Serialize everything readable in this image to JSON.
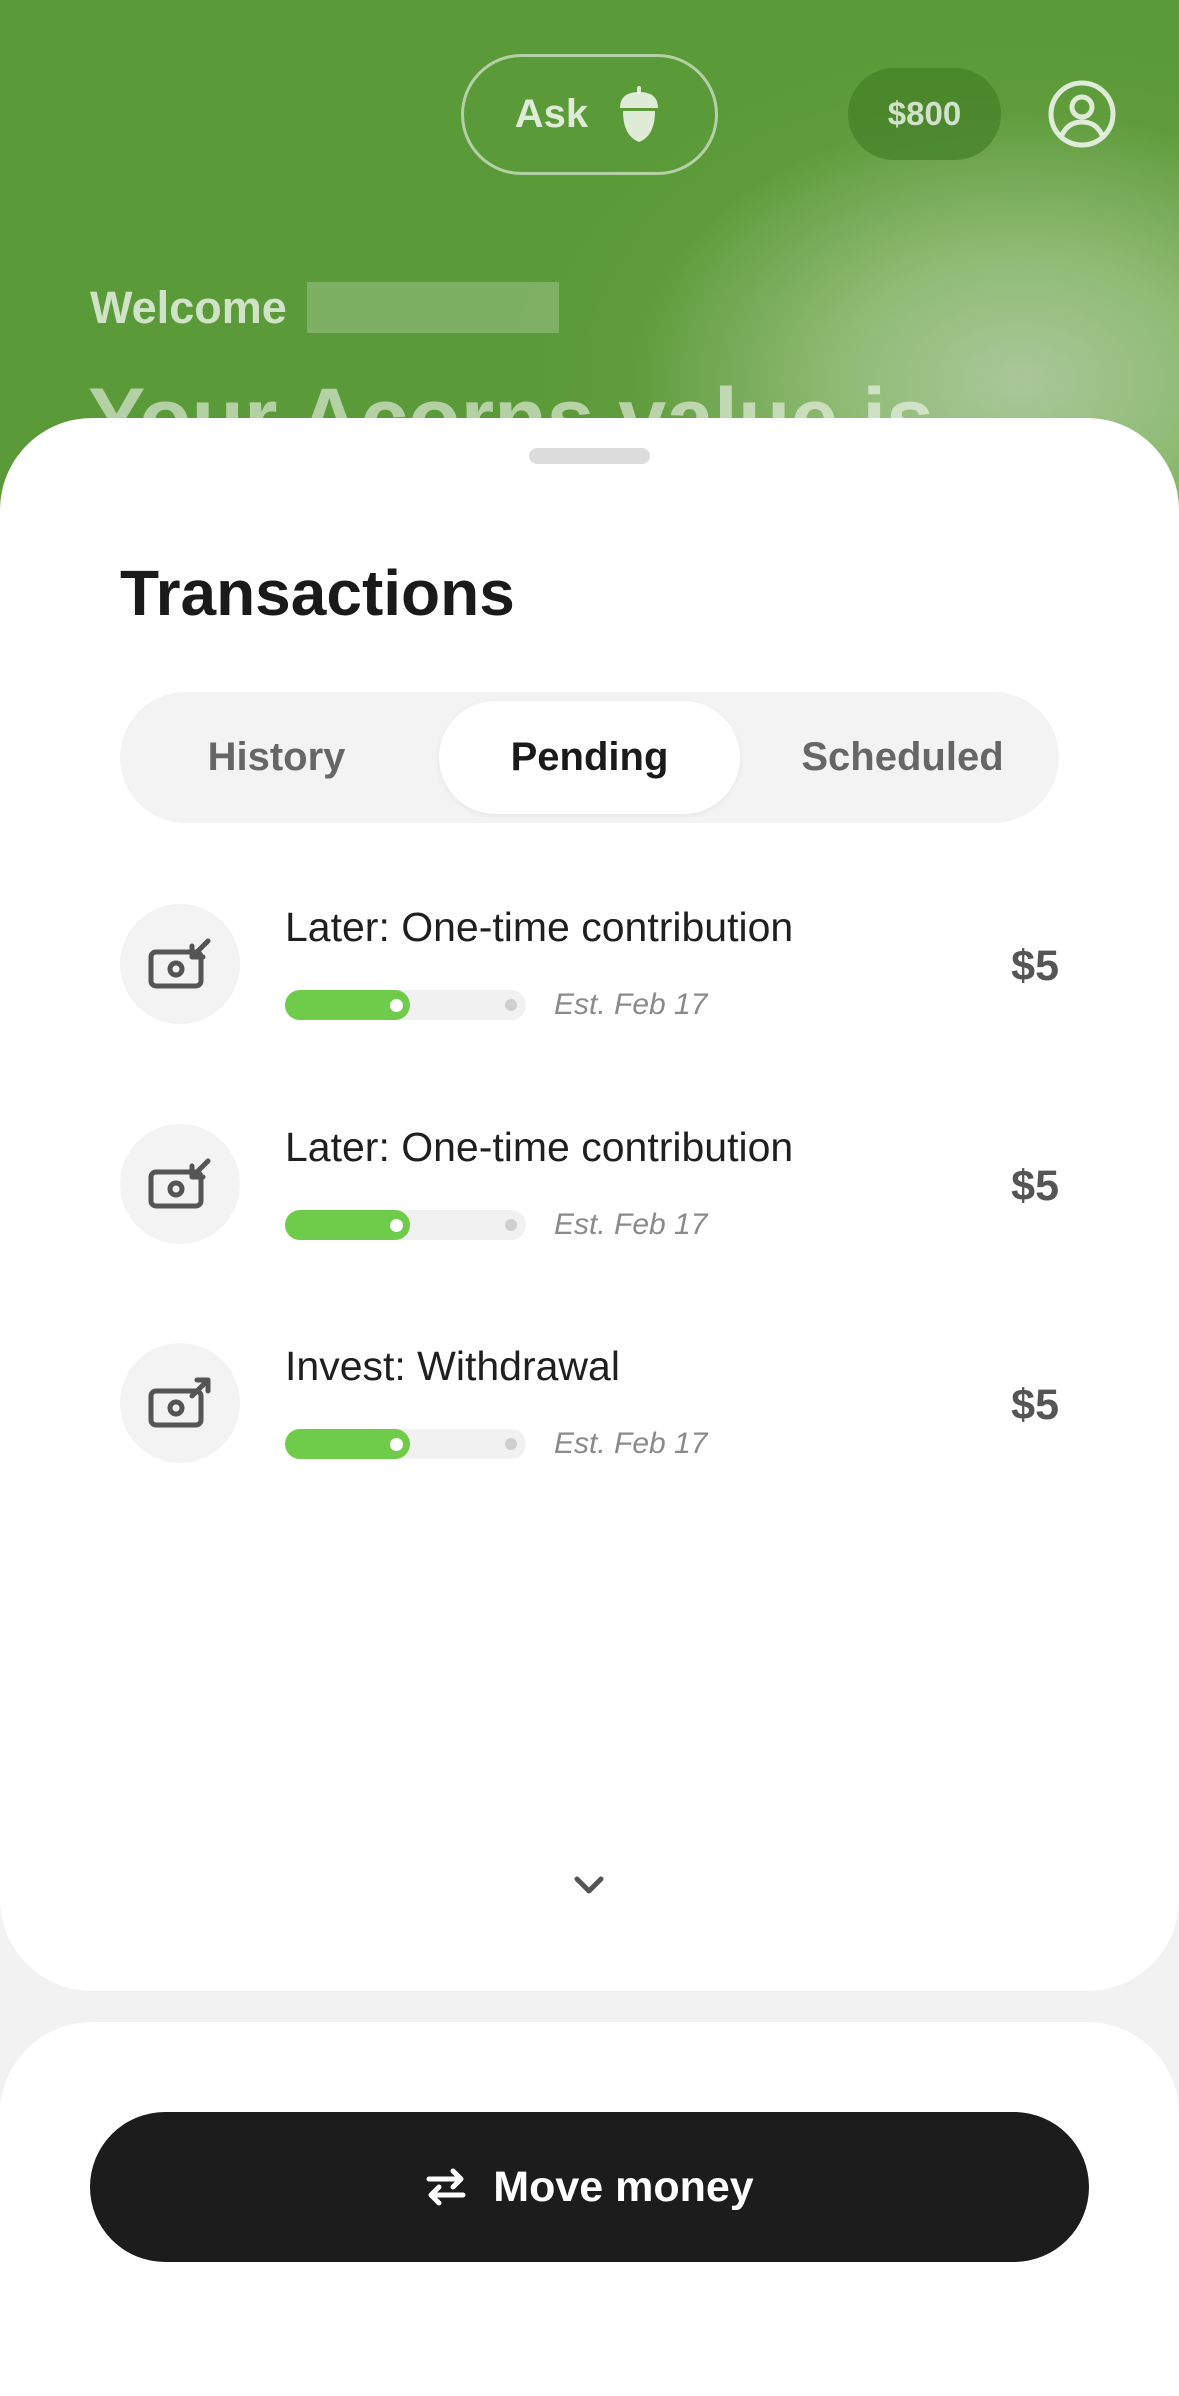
{
  "header": {
    "ask_label": "Ask",
    "balance": "$800",
    "welcome": "Welcome",
    "value_heading": "Your Acorns value is"
  },
  "sheet": {
    "title": "Transactions",
    "tabs": [
      {
        "label": "History"
      },
      {
        "label": "Pending"
      },
      {
        "label": "Scheduled"
      }
    ],
    "active_tab": "Pending",
    "transactions": [
      {
        "label": "Later: One-time contribution",
        "date": "Est. Feb 17",
        "amount": "$5",
        "icon": "cash-in-icon",
        "progress": 0.52
      },
      {
        "label": "Later: One-time contribution",
        "date": "Est. Feb 17",
        "amount": "$5",
        "icon": "cash-in-icon",
        "progress": 0.52
      },
      {
        "label": "Invest: Withdrawal",
        "date": "Est. Feb 17",
        "amount": "$5",
        "icon": "cash-out-icon",
        "progress": 0.52
      }
    ]
  },
  "footer": {
    "move_money_label": "Move money"
  },
  "colors": {
    "brand_green": "#5a9a38",
    "progress_green": "#6fcb4a",
    "button_dark": "#1c1c1c"
  }
}
